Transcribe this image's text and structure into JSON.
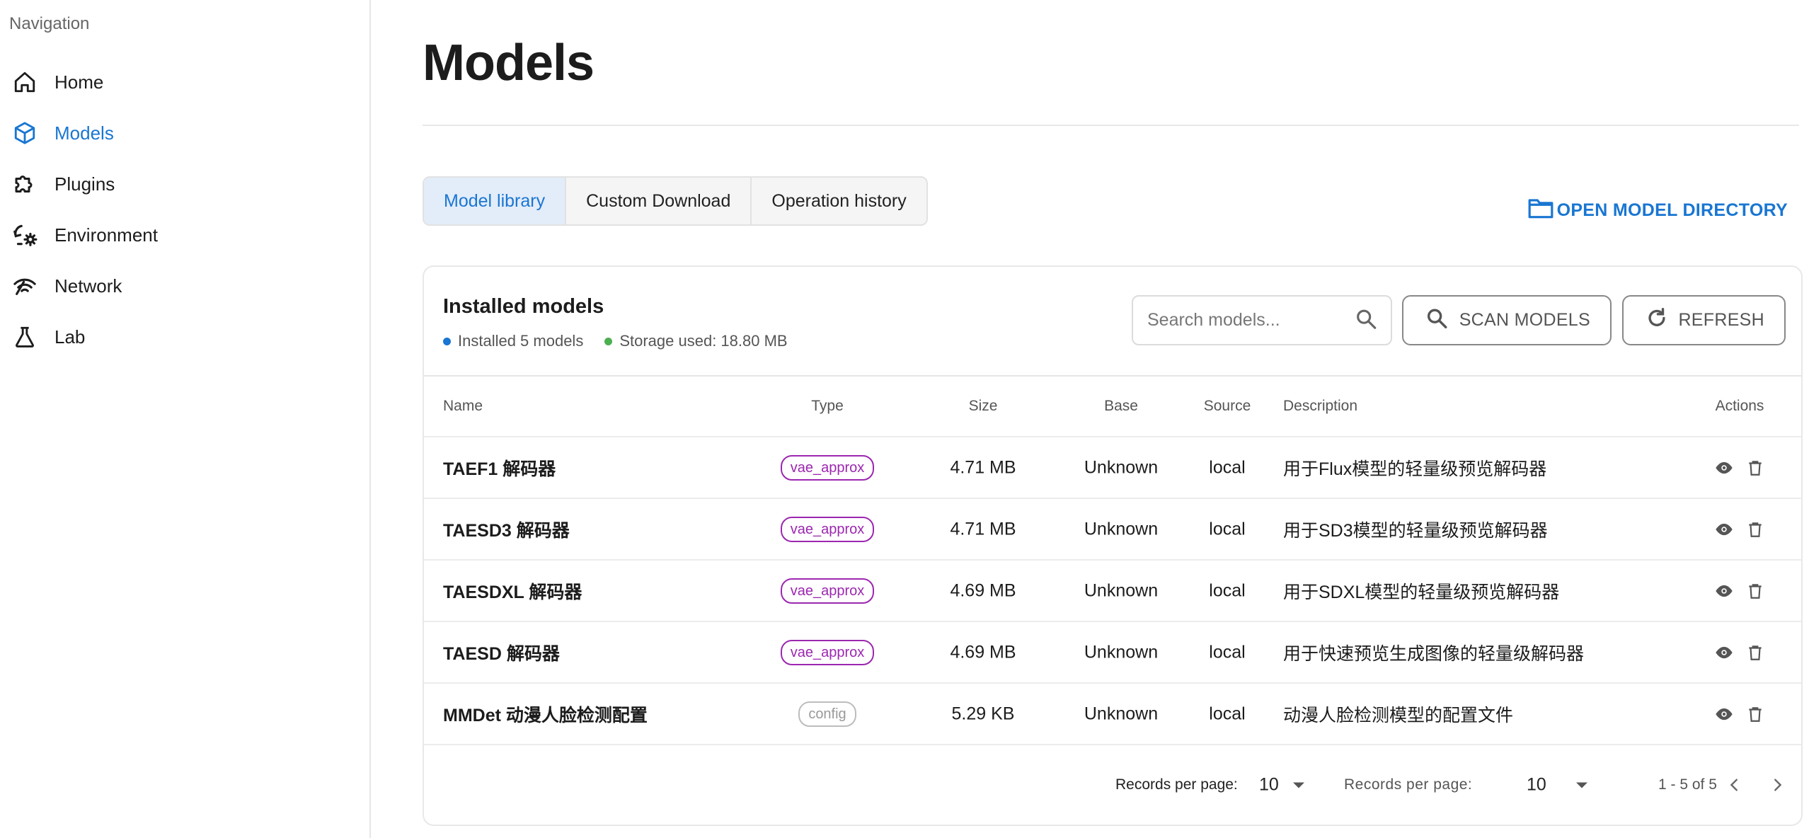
{
  "sidebar": {
    "heading": "Navigation",
    "items": [
      {
        "label": "Home",
        "icon": "home-icon",
        "active": false
      },
      {
        "label": "Models",
        "icon": "cube-icon",
        "active": true
      },
      {
        "label": "Plugins",
        "icon": "puzzle-icon",
        "active": false
      },
      {
        "label": "Environment",
        "icon": "environment-icon",
        "active": false
      },
      {
        "label": "Network",
        "icon": "network-icon",
        "active": false
      },
      {
        "label": "Lab",
        "icon": "flask-icon",
        "active": false
      }
    ]
  },
  "page": {
    "title": "Models"
  },
  "tabs": [
    {
      "label": "Model library",
      "active": true
    },
    {
      "label": "Custom Download",
      "active": false
    },
    {
      "label": "Operation history",
      "active": false
    }
  ],
  "open_dir_label": "OPEN MODEL DIRECTORY",
  "card": {
    "title": "Installed models",
    "installed_text": "Installed 5 models",
    "storage_text": "Storage used: 18.80 MB",
    "search_placeholder": "Search models...",
    "scan_label": "SCAN MODELS",
    "refresh_label": "REFRESH"
  },
  "table": {
    "headers": {
      "name": "Name",
      "type": "Type",
      "size": "Size",
      "base": "Base",
      "source": "Source",
      "description": "Description",
      "actions": "Actions"
    },
    "rows": [
      {
        "name": "TAEF1 解码器",
        "type": "vae_approx",
        "size": "4.71 MB",
        "base": "Unknown",
        "source": "local",
        "description": "用于Flux模型的轻量级预览解码器"
      },
      {
        "name": "TAESD3 解码器",
        "type": "vae_approx",
        "size": "4.71 MB",
        "base": "Unknown",
        "source": "local",
        "description": "用于SD3模型的轻量级预览解码器"
      },
      {
        "name": "TAESDXL 解码器",
        "type": "vae_approx",
        "size": "4.69 MB",
        "base": "Unknown",
        "source": "local",
        "description": "用于SDXL模型的轻量级预览解码器"
      },
      {
        "name": "TAESD 解码器",
        "type": "vae_approx",
        "size": "4.69 MB",
        "base": "Unknown",
        "source": "local",
        "description": "用于快速预览生成图像的轻量级解码器"
      },
      {
        "name": "MMDet 动漫人脸检测配置",
        "type": "config",
        "size": "5.29 KB",
        "base": "Unknown",
        "source": "local",
        "description": "动漫人脸检测模型的配置文件"
      }
    ]
  },
  "footer": {
    "per_page_label_1": "Records per page:",
    "per_page_value_1": "10",
    "per_page_label_2": "Records per page:",
    "per_page_value_2": "10",
    "range_text": "1 - 5 of 5"
  },
  "colors": {
    "accent": "#1976d2",
    "installed_dot": "#1976d2",
    "storage_dot": "#4caf50",
    "chip_vae": "#9c27b0",
    "chip_config": "#bdbdbd"
  }
}
